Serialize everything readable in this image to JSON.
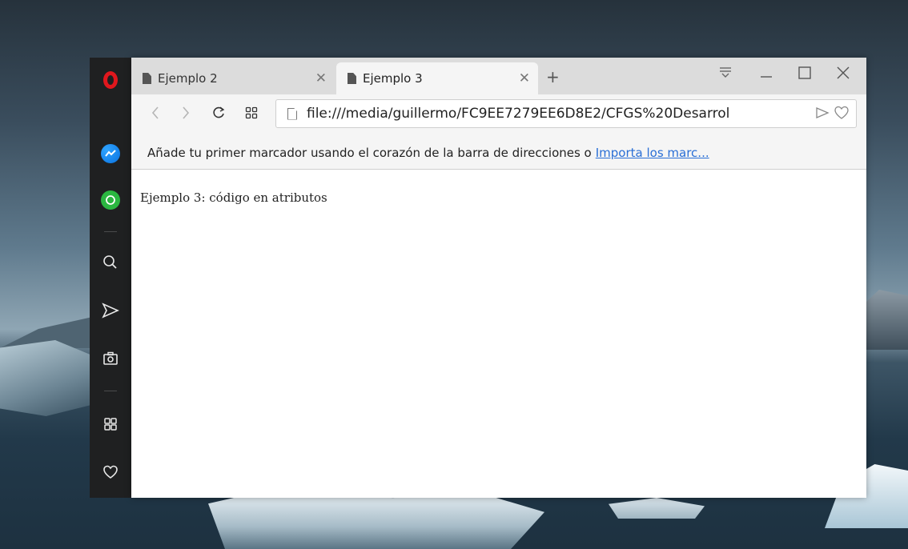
{
  "sidebar": {
    "items": [
      {
        "icon": "opera-logo-icon"
      },
      {
        "icon": "messenger-icon"
      },
      {
        "icon": "whatsapp-icon"
      },
      {
        "icon": "search-icon"
      },
      {
        "icon": "send-icon"
      },
      {
        "icon": "camera-icon"
      },
      {
        "icon": "speed-dial-icon"
      },
      {
        "icon": "heart-icon"
      }
    ]
  },
  "tabs": [
    {
      "label": "Ejemplo 2",
      "active": false
    },
    {
      "label": "Ejemplo 3",
      "active": true
    }
  ],
  "address": {
    "url": "file:///media/guillermo/FC9EE7279EE6D8E2/CFGS%20Desarrol"
  },
  "bookmarks": {
    "message": "Añade tu primer marcador usando el corazón de la barra de direcciones o",
    "import_link": "Importa los marc..."
  },
  "page": {
    "text": "Ejemplo 3: código en atributos"
  },
  "colors": {
    "opera_red": "#e0171d",
    "link_blue": "#2a6fd6",
    "sidebar_bg": "#1f2021",
    "tabbar_bg": "#dcdcdc"
  }
}
